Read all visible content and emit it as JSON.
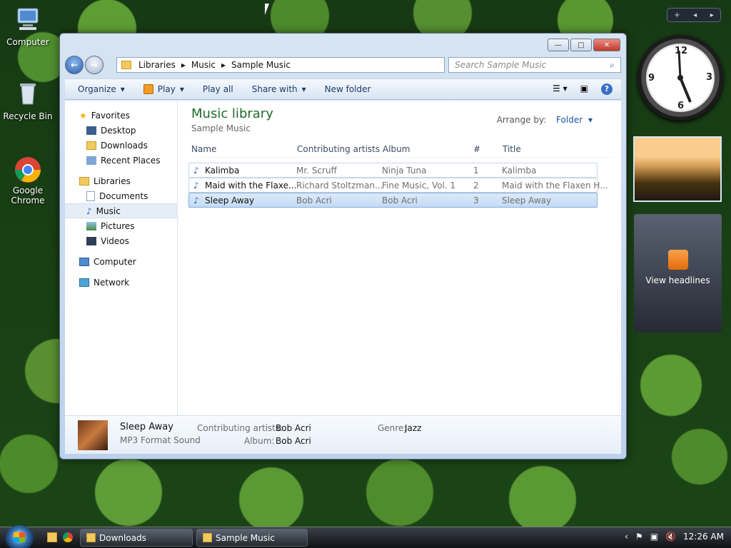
{
  "desktop": {
    "icons": [
      {
        "label": "Computer"
      },
      {
        "label": "Recycle Bin"
      },
      {
        "label": "Google Chrome"
      }
    ]
  },
  "explorer": {
    "breadcrumbs": [
      "Libraries",
      "Music",
      "Sample Music"
    ],
    "search_placeholder": "Search Sample Music",
    "toolbar": {
      "organize": "Organize",
      "play": "Play",
      "play_all": "Play all",
      "share_with": "Share with",
      "new_folder": "New folder"
    },
    "nav": {
      "favorites": "Favorites",
      "desktop": "Desktop",
      "downloads": "Downloads",
      "recent": "Recent Places",
      "libraries": "Libraries",
      "documents": "Documents",
      "music": "Music",
      "pictures": "Pictures",
      "videos": "Videos",
      "computer": "Computer",
      "network": "Network"
    },
    "main": {
      "title": "Music library",
      "subtitle": "Sample Music",
      "arrange_label": "Arrange by:",
      "arrange_value": "Folder",
      "columns": [
        "Name",
        "Contributing artists",
        "Album",
        "#",
        "Title"
      ],
      "rows": [
        {
          "name": "Kalimba",
          "artist": "Mr. Scruff",
          "album": "Ninja Tuna",
          "num": "1",
          "title": "Kalimba"
        },
        {
          "name": "Maid with the Flaxe...",
          "artist": "Richard Stoltzman...",
          "album": "Fine Music, Vol. 1",
          "num": "2",
          "title": "Maid with the Flaxen H..."
        },
        {
          "name": "Sleep Away",
          "artist": "Bob Acri",
          "album": "Bob Acri",
          "num": "3",
          "title": "Sleep Away"
        }
      ]
    },
    "details": {
      "title": "Sleep Away",
      "type": "MP3 Format Sound",
      "artists_label": "Contributing artists:",
      "artists_value": "Bob Acri",
      "album_label": "Album:",
      "album_value": "Bob Acri",
      "genre_label": "Genre:",
      "genre_value": "Jazz"
    }
  },
  "gadgets": {
    "feed_label": "View headlines"
  },
  "taskbar": {
    "downloads": "Downloads",
    "sample_music": "Sample Music",
    "time": "12:26 AM"
  }
}
